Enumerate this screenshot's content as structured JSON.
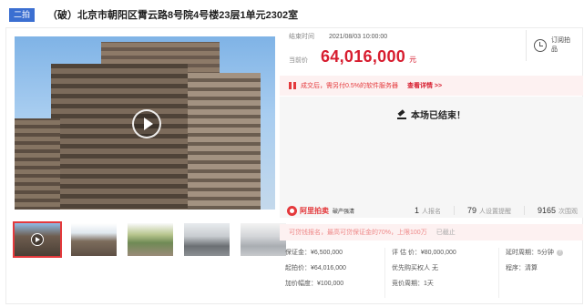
{
  "header": {
    "round_tag": "二拍",
    "title": "（破）北京市朝阳区霄云路8号院4号楼23层1单元2302室"
  },
  "media": {
    "main_image": "building-photo",
    "thumbnails": [
      "thumb-1",
      "thumb-2",
      "thumb-3",
      "thumb-4",
      "thumb-5"
    ]
  },
  "auction": {
    "end_time_label": "结束时间",
    "end_time": "2021/08/03 10:00:00",
    "price_label": "当前价",
    "price": "64,016,000",
    "price_unit": "元",
    "remind_label": "订阅拍品",
    "fee_notice": "成交后，需另付0.5%的软件服务器",
    "fee_link": "查看详情 >>",
    "ended_text": "本场已结束！"
  },
  "platform": {
    "brand": "阿里拍卖",
    "sub": "破产强清",
    "stats": [
      {
        "value": "1",
        "label": "人报名"
      },
      {
        "value": "79",
        "label": "人设置提醒"
      },
      {
        "value": "9165",
        "label": "次围观"
      }
    ]
  },
  "loan": {
    "text": "可贷钱报名，最高可贷保证金的70%，上限100万",
    "status": "已截止"
  },
  "details": {
    "deposit": "保证金：¥6,500,000",
    "start_price": "起拍价：¥64,016,000",
    "increment": "加价幅度：¥100,000",
    "appraisal": "评 估 价：¥80,000,000",
    "priority": "优先购买权人 无",
    "cycle": "竞价周期：1天",
    "delay": "延时周期：5分钟",
    "process": "程序：清算"
  },
  "colors": {
    "accent": "#e4393c",
    "price": "#d71d2f",
    "tag_bg": "#3b6fd1"
  }
}
